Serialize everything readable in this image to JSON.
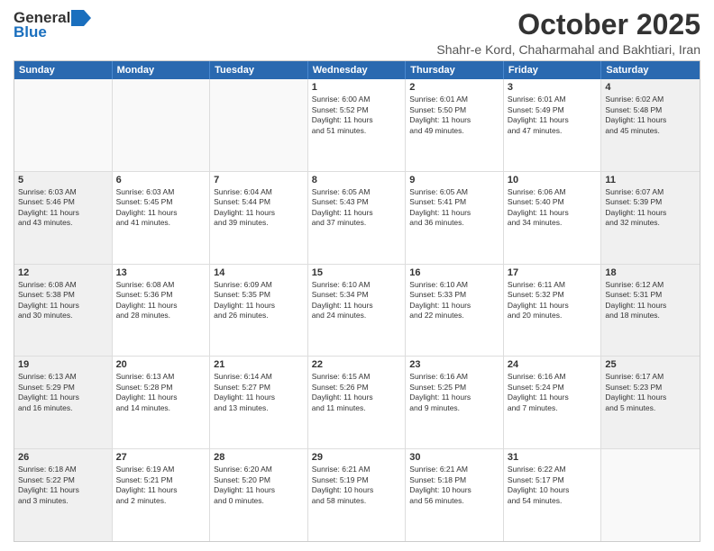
{
  "logo": {
    "general": "General",
    "blue": "Blue"
  },
  "title": "October 2025",
  "subtitle": "Shahr-e Kord, Chaharmahal and Bakhtiari, Iran",
  "header": {
    "days": [
      "Sunday",
      "Monday",
      "Tuesday",
      "Wednesday",
      "Thursday",
      "Friday",
      "Saturday"
    ]
  },
  "weeks": [
    [
      {
        "day": "",
        "info": ""
      },
      {
        "day": "",
        "info": ""
      },
      {
        "day": "",
        "info": ""
      },
      {
        "day": "1",
        "info": "Sunrise: 6:00 AM\nSunset: 5:52 PM\nDaylight: 11 hours\nand 51 minutes."
      },
      {
        "day": "2",
        "info": "Sunrise: 6:01 AM\nSunset: 5:50 PM\nDaylight: 11 hours\nand 49 minutes."
      },
      {
        "day": "3",
        "info": "Sunrise: 6:01 AM\nSunset: 5:49 PM\nDaylight: 11 hours\nand 47 minutes."
      },
      {
        "day": "4",
        "info": "Sunrise: 6:02 AM\nSunset: 5:48 PM\nDaylight: 11 hours\nand 45 minutes."
      }
    ],
    [
      {
        "day": "5",
        "info": "Sunrise: 6:03 AM\nSunset: 5:46 PM\nDaylight: 11 hours\nand 43 minutes."
      },
      {
        "day": "6",
        "info": "Sunrise: 6:03 AM\nSunset: 5:45 PM\nDaylight: 11 hours\nand 41 minutes."
      },
      {
        "day": "7",
        "info": "Sunrise: 6:04 AM\nSunset: 5:44 PM\nDaylight: 11 hours\nand 39 minutes."
      },
      {
        "day": "8",
        "info": "Sunrise: 6:05 AM\nSunset: 5:43 PM\nDaylight: 11 hours\nand 37 minutes."
      },
      {
        "day": "9",
        "info": "Sunrise: 6:05 AM\nSunset: 5:41 PM\nDaylight: 11 hours\nand 36 minutes."
      },
      {
        "day": "10",
        "info": "Sunrise: 6:06 AM\nSunset: 5:40 PM\nDaylight: 11 hours\nand 34 minutes."
      },
      {
        "day": "11",
        "info": "Sunrise: 6:07 AM\nSunset: 5:39 PM\nDaylight: 11 hours\nand 32 minutes."
      }
    ],
    [
      {
        "day": "12",
        "info": "Sunrise: 6:08 AM\nSunset: 5:38 PM\nDaylight: 11 hours\nand 30 minutes."
      },
      {
        "day": "13",
        "info": "Sunrise: 6:08 AM\nSunset: 5:36 PM\nDaylight: 11 hours\nand 28 minutes."
      },
      {
        "day": "14",
        "info": "Sunrise: 6:09 AM\nSunset: 5:35 PM\nDaylight: 11 hours\nand 26 minutes."
      },
      {
        "day": "15",
        "info": "Sunrise: 6:10 AM\nSunset: 5:34 PM\nDaylight: 11 hours\nand 24 minutes."
      },
      {
        "day": "16",
        "info": "Sunrise: 6:10 AM\nSunset: 5:33 PM\nDaylight: 11 hours\nand 22 minutes."
      },
      {
        "day": "17",
        "info": "Sunrise: 6:11 AM\nSunset: 5:32 PM\nDaylight: 11 hours\nand 20 minutes."
      },
      {
        "day": "18",
        "info": "Sunrise: 6:12 AM\nSunset: 5:31 PM\nDaylight: 11 hours\nand 18 minutes."
      }
    ],
    [
      {
        "day": "19",
        "info": "Sunrise: 6:13 AM\nSunset: 5:29 PM\nDaylight: 11 hours\nand 16 minutes."
      },
      {
        "day": "20",
        "info": "Sunrise: 6:13 AM\nSunset: 5:28 PM\nDaylight: 11 hours\nand 14 minutes."
      },
      {
        "day": "21",
        "info": "Sunrise: 6:14 AM\nSunset: 5:27 PM\nDaylight: 11 hours\nand 13 minutes."
      },
      {
        "day": "22",
        "info": "Sunrise: 6:15 AM\nSunset: 5:26 PM\nDaylight: 11 hours\nand 11 minutes."
      },
      {
        "day": "23",
        "info": "Sunrise: 6:16 AM\nSunset: 5:25 PM\nDaylight: 11 hours\nand 9 minutes."
      },
      {
        "day": "24",
        "info": "Sunrise: 6:16 AM\nSunset: 5:24 PM\nDaylight: 11 hours\nand 7 minutes."
      },
      {
        "day": "25",
        "info": "Sunrise: 6:17 AM\nSunset: 5:23 PM\nDaylight: 11 hours\nand 5 minutes."
      }
    ],
    [
      {
        "day": "26",
        "info": "Sunrise: 6:18 AM\nSunset: 5:22 PM\nDaylight: 11 hours\nand 3 minutes."
      },
      {
        "day": "27",
        "info": "Sunrise: 6:19 AM\nSunset: 5:21 PM\nDaylight: 11 hours\nand 2 minutes."
      },
      {
        "day": "28",
        "info": "Sunrise: 6:20 AM\nSunset: 5:20 PM\nDaylight: 11 hours\nand 0 minutes."
      },
      {
        "day": "29",
        "info": "Sunrise: 6:21 AM\nSunset: 5:19 PM\nDaylight: 10 hours\nand 58 minutes."
      },
      {
        "day": "30",
        "info": "Sunrise: 6:21 AM\nSunset: 5:18 PM\nDaylight: 10 hours\nand 56 minutes."
      },
      {
        "day": "31",
        "info": "Sunrise: 6:22 AM\nSunset: 5:17 PM\nDaylight: 10 hours\nand 54 minutes."
      },
      {
        "day": "",
        "info": ""
      }
    ]
  ]
}
